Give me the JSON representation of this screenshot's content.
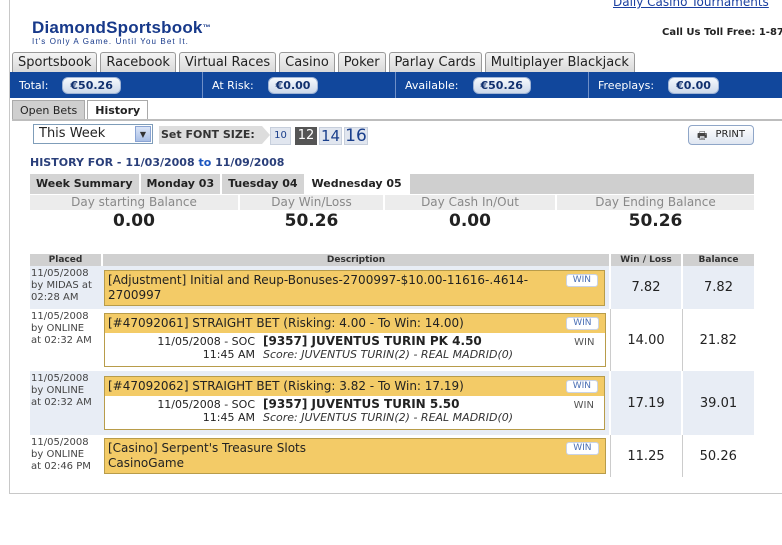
{
  "header": {
    "top_link": "Daily Casino Tournaments",
    "logo_main": "DiamondSportsbook",
    "logo_tm": "™",
    "logo_tagline": "It's Only A Game. Until You Bet It.",
    "toll_free": "Call Us Toll Free: 1-87"
  },
  "main_tabs": [
    "Sportsbook",
    "Racebook",
    "Virtual Races",
    "Casino",
    "Poker",
    "Parlay Cards",
    "Multiplayer Blackjack"
  ],
  "balances": [
    {
      "label": "Total:",
      "value": "€50.26"
    },
    {
      "label": "At Risk:",
      "value": "€0.00"
    },
    {
      "label": "Available:",
      "value": "€50.26"
    },
    {
      "label": "Freeplays:",
      "value": "€0.00"
    }
  ],
  "sub_tabs": [
    "Open Bets",
    "History"
  ],
  "filter": {
    "period": "This Week",
    "font_label": "Set FONT SIZE:",
    "font_sizes": [
      "10",
      "12",
      "14",
      "16"
    ],
    "selected_font": "12",
    "print_label": "PRINT"
  },
  "history_for": {
    "prefix": "HISTORY FOR",
    "dash": "-",
    "from": "11/03/2008",
    "to_word": "to",
    "to": "11/09/2008"
  },
  "day_tabs": [
    "Week Summary",
    "Monday 03",
    "Tuesday 04",
    "Wednesday 05"
  ],
  "active_day": "Wednesday 05",
  "summary": [
    {
      "label": "Day starting Balance",
      "value": "0.00"
    },
    {
      "label": "Day Win/Loss",
      "value": "50.26"
    },
    {
      "label": "Day Cash In/Out",
      "value": "0.00"
    },
    {
      "label": "Day Ending Balance",
      "value": "50.26"
    }
  ],
  "table": {
    "headers": {
      "placed": "Placed",
      "description": "Description",
      "winloss": "Win / Loss",
      "balance": "Balance"
    },
    "rows": [
      {
        "placed_date": "11/05/2008",
        "placed_by": "by MIDAS at",
        "placed_time": "02:28 AM",
        "head": "[Adjustment]  Initial and Reup-Bonuses-2700997-$10.00-11616-.4614-2700997",
        "badge": "WIN",
        "win_loss": "7.82",
        "balance": "7.82"
      },
      {
        "placed_date": "11/05/2008",
        "placed_by": "by ONLINE",
        "placed_time": "at 02:32 AM",
        "head_id": "[#47092061]  STRAIGHT BET",
        "head_risk": "(Risking: 4.00 - To Win: 14.00)",
        "badge": "WIN",
        "detail_date": "11/05/2008 - SOC",
        "detail_time": "11:45 AM",
        "pick": "[9357] JUVENTUS TURIN PK 4.50",
        "score": "Score: JUVENTUS TURIN(2) - REAL MADRID(0)",
        "result": "WIN",
        "win_loss": "14.00",
        "balance": "21.82"
      },
      {
        "placed_date": "11/05/2008",
        "placed_by": "by ONLINE",
        "placed_time": "at 02:32 AM",
        "head_id": "[#47092062]  STRAIGHT BET",
        "head_risk": "(Risking: 3.82 - To Win: 17.19)",
        "badge": "WIN",
        "detail_date": "11/05/2008 - SOC",
        "detail_time": "11:45 AM",
        "pick": "[9357] JUVENTUS TURIN 5.50",
        "score": "Score: JUVENTUS TURIN(2) - REAL MADRID(0)",
        "result": "WIN",
        "win_loss": "17.19",
        "balance": "39.01"
      },
      {
        "placed_date": "11/05/2008",
        "placed_by": "by ONLINE",
        "placed_time": "at 02:46 PM",
        "head": "[Casino]  Serpent's Treasure Slots",
        "head2": "CasinoGame",
        "badge": "WIN",
        "win_loss": "11.25",
        "balance": "50.26"
      }
    ]
  },
  "colors": {
    "brand_blue": "#11479c",
    "bet_header_gold": "#f3cb67",
    "row_alt": "#e8edf5"
  },
  "icons": {
    "dropdown": "chevron-down-icon",
    "print": "printer-icon"
  }
}
